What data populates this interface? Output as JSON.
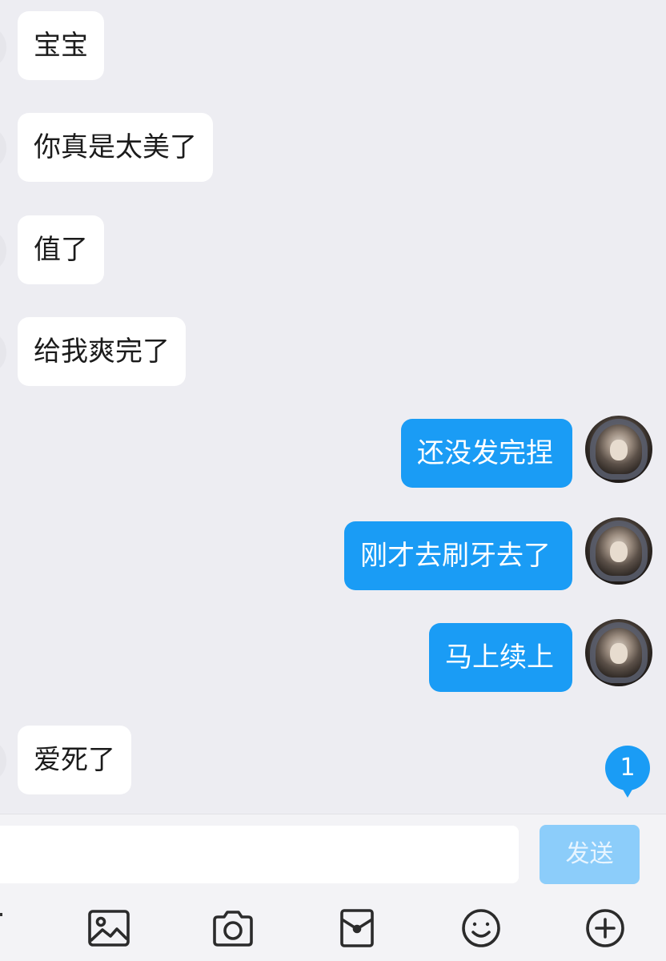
{
  "messages": [
    {
      "side": "in",
      "text": "宝宝"
    },
    {
      "side": "in",
      "text": "你真是太美了"
    },
    {
      "side": "in",
      "text": "值了"
    },
    {
      "side": "in",
      "text": "给我爽完了"
    },
    {
      "side": "out",
      "text": "还没发完捏"
    },
    {
      "side": "out",
      "text": "刚才去刷牙去了"
    },
    {
      "side": "out",
      "text": "马上续上"
    },
    {
      "side": "in",
      "text": "爱死了"
    }
  ],
  "unread_badge": {
    "count": "1"
  },
  "composer": {
    "input_value": "",
    "send_label": "发送"
  },
  "toolbar": {
    "items": [
      {
        "icon": "image-icon"
      },
      {
        "icon": "camera-icon"
      },
      {
        "icon": "red-packet-icon"
      },
      {
        "icon": "emoji-icon"
      },
      {
        "icon": "plus-circle-icon"
      }
    ]
  },
  "colors": {
    "background": "#ededf2",
    "incoming_bubble": "#ffffff",
    "outgoing_bubble": "#1a9cf5",
    "send_button_disabled": "#8ccdfa"
  }
}
